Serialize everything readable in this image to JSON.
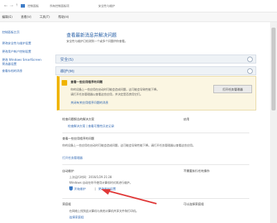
{
  "titlebar": {
    "breadcrumb": [
      "控制面板",
      "所有控制面板项",
      "安全性与维护"
    ]
  },
  "menubar": {
    "items": [
      "编辑(E)",
      "查看(V)",
      "工具(T)",
      "帮助(H)"
    ]
  },
  "sidebar": {
    "items": [
      "控制面板主页",
      "更改安全性与维护设置",
      "更改用户帐户控制设置",
      "更改 Windows SmartScreen 筛选器设置",
      "查看存档的消息"
    ]
  },
  "main": {
    "title": "查看最新消息并解决问题",
    "subtitle": "安全性与维护已检测到一个或多个问题供你查看。",
    "security": {
      "label": "安全(S)"
    },
    "maintenance": {
      "label": "维护(M)",
      "warning": {
        "title": "查看一些应用程序的问题",
        "body_line1": "你的设备上一些应用在启动时可能会造成问题，这可能会导致性能下降。",
        "body_line2": "请打开任务管理器以查看这些应用，并决定是否禁用它们。",
        "link": "关闭有关应用程序问题的消息",
        "button": "打开任务管理器"
      },
      "rows": [
        {
          "label": "检查问题报告的解决方案",
          "status": "启用",
          "link": "检查解决方案 | 查看可靠性历史记录"
        },
        {
          "label": "查看一些应用程序的问题",
          "desc": "你的设备上一些应用在启动时可能会造成问题，这可能会导致性能下降。请打开任务管理器以查看这些应用。",
          "link": "打开任务管理器"
        },
        {
          "label": "自动维护",
          "status": "不需要执行任何操作",
          "last_run": "上次运行时间：2016/1/29 21:28",
          "desc": "Windows 自动在你不使用计算机时对其进行维护。",
          "links": [
            "开始维护",
            "更改维护设置"
          ]
        },
        {
          "label": "家庭组",
          "status": "可以连接家庭组",
          "desc": "在网络上找到此计算机与其他计算机共享文件和打印机。",
          "link": "连接家庭组"
        }
      ]
    }
  },
  "colors": {
    "accent": "#2a63b0",
    "warning": "#f0b400",
    "annotation_arrow": "#e03a3a"
  }
}
